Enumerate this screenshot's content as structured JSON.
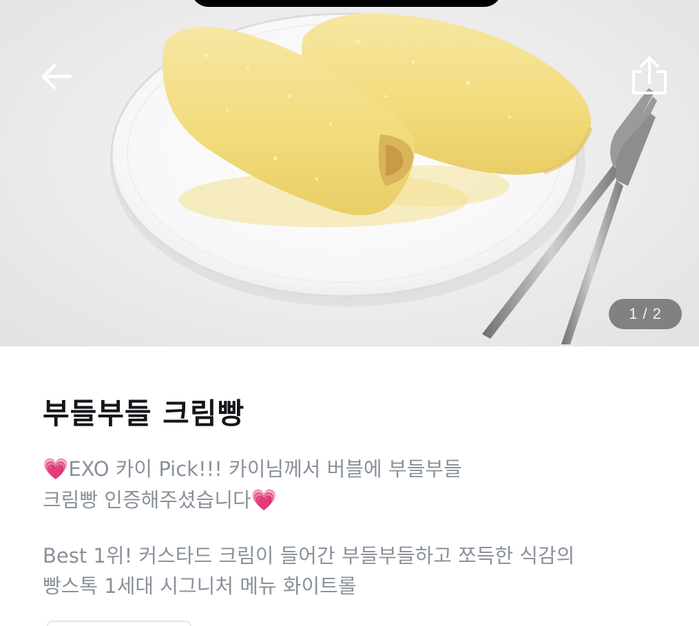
{
  "header": {
    "back_icon": "arrow-left-icon",
    "share_icon": "share-icon"
  },
  "gallery": {
    "counter": "1 / 2"
  },
  "product": {
    "title": "부들부들 크림빵",
    "promo_heart": "💗",
    "promo_line1": "EXO 카이 Pick!!! 카이님께서 버블에 부들부들",
    "promo_line2": "크림빵 인증해주셨습니다",
    "promo_heart_end": "💗",
    "desc_line1": "Best 1위! 커스타드 크림이 들어간 부들부들하고 쪼득한 식감의",
    "desc_line2": "빵스톡 1세대 시그니처 메뉴 화이트롤"
  },
  "colors": {
    "title": "#15161a",
    "description": "#8a919a",
    "heart": "#ff2fa6",
    "counter_bg": "#5a5a5a"
  }
}
